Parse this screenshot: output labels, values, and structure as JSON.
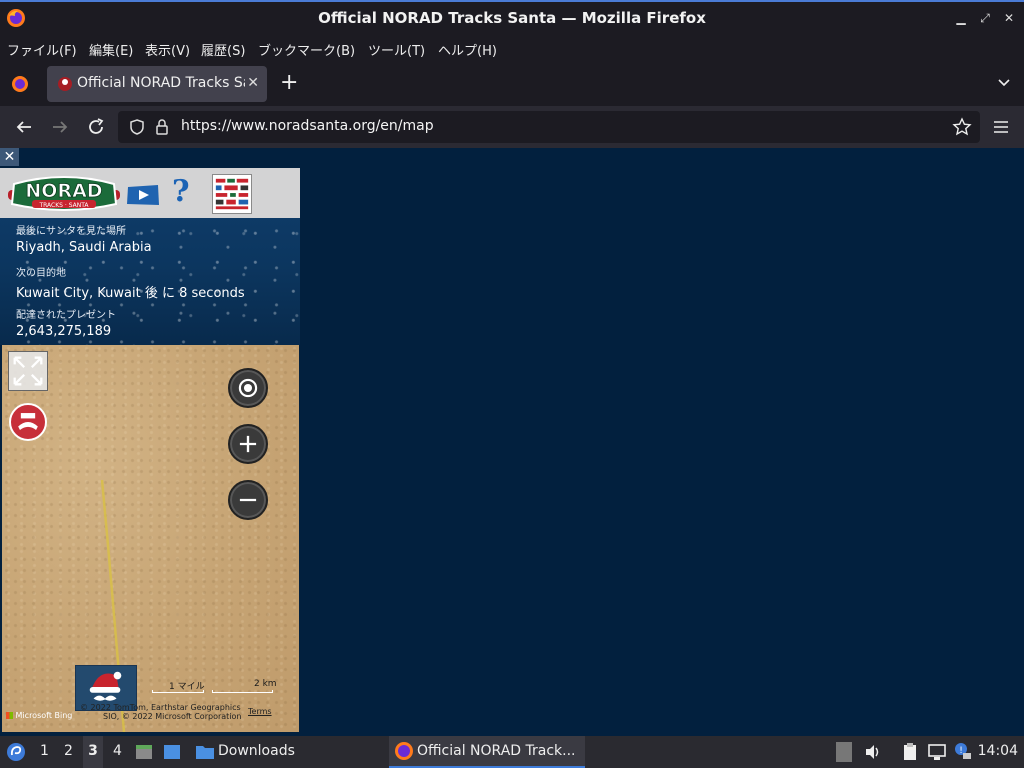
{
  "window": {
    "title": "Official NORAD Tracks Santa — Mozilla Firefox"
  },
  "menubar": {
    "items": [
      "ファイル(F)",
      "編集(E)",
      "表示(V)",
      "履歴(S)",
      "ブックマーク(B)",
      "ツール(T)",
      "ヘルプ(H)"
    ]
  },
  "tabs": [
    {
      "label": "Official NORAD Tracks Santa",
      "active": true
    }
  ],
  "navbar": {
    "url": "https://www.noradsanta.org/en/map"
  },
  "tracker": {
    "last_seen_label": "最後にサンタを見た場所",
    "last_seen_value": "Riyadh, Saudi Arabia",
    "next_stop_label": "次の目的地",
    "next_stop_value": "Kuwait City, Kuwait 後 に 8 seconds",
    "gifts_label": "配達されたプレゼント",
    "gifts_value": "2,643,275,189"
  },
  "map": {
    "scale_imperial": "1 マイル",
    "scale_metric": "2 km",
    "attribution_line1": "© 2022 TomTom, Earthstar Geographics",
    "attribution_line2": "SIO, © 2022 Microsoft Corporation",
    "terms": "Terms",
    "provider": "Microsoft Bing"
  },
  "taskbar": {
    "workspaces": [
      "1",
      "2",
      "3",
      "4"
    ],
    "active_workspace": "3",
    "downloads": "Downloads",
    "active_window": "Official NORAD Track...",
    "clock": "14:04"
  },
  "colors": {
    "page_bg": "#02203e",
    "accent": "#3d7bd9"
  }
}
